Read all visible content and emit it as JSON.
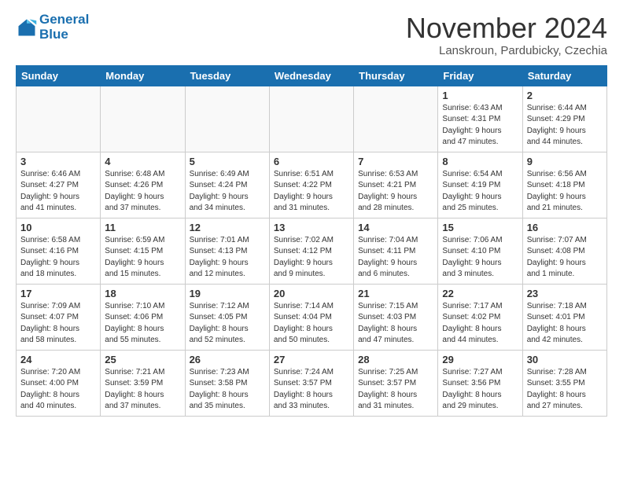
{
  "logo": {
    "line1": "General",
    "line2": "Blue"
  },
  "title": "November 2024",
  "location": "Lanskroun, Pardubicky, Czechia",
  "header_days": [
    "Sunday",
    "Monday",
    "Tuesday",
    "Wednesday",
    "Thursday",
    "Friday",
    "Saturday"
  ],
  "weeks": [
    [
      {
        "day": "",
        "info": ""
      },
      {
        "day": "",
        "info": ""
      },
      {
        "day": "",
        "info": ""
      },
      {
        "day": "",
        "info": ""
      },
      {
        "day": "",
        "info": ""
      },
      {
        "day": "1",
        "info": "Sunrise: 6:43 AM\nSunset: 4:31 PM\nDaylight: 9 hours\nand 47 minutes."
      },
      {
        "day": "2",
        "info": "Sunrise: 6:44 AM\nSunset: 4:29 PM\nDaylight: 9 hours\nand 44 minutes."
      }
    ],
    [
      {
        "day": "3",
        "info": "Sunrise: 6:46 AM\nSunset: 4:27 PM\nDaylight: 9 hours\nand 41 minutes."
      },
      {
        "day": "4",
        "info": "Sunrise: 6:48 AM\nSunset: 4:26 PM\nDaylight: 9 hours\nand 37 minutes."
      },
      {
        "day": "5",
        "info": "Sunrise: 6:49 AM\nSunset: 4:24 PM\nDaylight: 9 hours\nand 34 minutes."
      },
      {
        "day": "6",
        "info": "Sunrise: 6:51 AM\nSunset: 4:22 PM\nDaylight: 9 hours\nand 31 minutes."
      },
      {
        "day": "7",
        "info": "Sunrise: 6:53 AM\nSunset: 4:21 PM\nDaylight: 9 hours\nand 28 minutes."
      },
      {
        "day": "8",
        "info": "Sunrise: 6:54 AM\nSunset: 4:19 PM\nDaylight: 9 hours\nand 25 minutes."
      },
      {
        "day": "9",
        "info": "Sunrise: 6:56 AM\nSunset: 4:18 PM\nDaylight: 9 hours\nand 21 minutes."
      }
    ],
    [
      {
        "day": "10",
        "info": "Sunrise: 6:58 AM\nSunset: 4:16 PM\nDaylight: 9 hours\nand 18 minutes."
      },
      {
        "day": "11",
        "info": "Sunrise: 6:59 AM\nSunset: 4:15 PM\nDaylight: 9 hours\nand 15 minutes."
      },
      {
        "day": "12",
        "info": "Sunrise: 7:01 AM\nSunset: 4:13 PM\nDaylight: 9 hours\nand 12 minutes."
      },
      {
        "day": "13",
        "info": "Sunrise: 7:02 AM\nSunset: 4:12 PM\nDaylight: 9 hours\nand 9 minutes."
      },
      {
        "day": "14",
        "info": "Sunrise: 7:04 AM\nSunset: 4:11 PM\nDaylight: 9 hours\nand 6 minutes."
      },
      {
        "day": "15",
        "info": "Sunrise: 7:06 AM\nSunset: 4:10 PM\nDaylight: 9 hours\nand 3 minutes."
      },
      {
        "day": "16",
        "info": "Sunrise: 7:07 AM\nSunset: 4:08 PM\nDaylight: 9 hours\nand 1 minute."
      }
    ],
    [
      {
        "day": "17",
        "info": "Sunrise: 7:09 AM\nSunset: 4:07 PM\nDaylight: 8 hours\nand 58 minutes."
      },
      {
        "day": "18",
        "info": "Sunrise: 7:10 AM\nSunset: 4:06 PM\nDaylight: 8 hours\nand 55 minutes."
      },
      {
        "day": "19",
        "info": "Sunrise: 7:12 AM\nSunset: 4:05 PM\nDaylight: 8 hours\nand 52 minutes."
      },
      {
        "day": "20",
        "info": "Sunrise: 7:14 AM\nSunset: 4:04 PM\nDaylight: 8 hours\nand 50 minutes."
      },
      {
        "day": "21",
        "info": "Sunrise: 7:15 AM\nSunset: 4:03 PM\nDaylight: 8 hours\nand 47 minutes."
      },
      {
        "day": "22",
        "info": "Sunrise: 7:17 AM\nSunset: 4:02 PM\nDaylight: 8 hours\nand 44 minutes."
      },
      {
        "day": "23",
        "info": "Sunrise: 7:18 AM\nSunset: 4:01 PM\nDaylight: 8 hours\nand 42 minutes."
      }
    ],
    [
      {
        "day": "24",
        "info": "Sunrise: 7:20 AM\nSunset: 4:00 PM\nDaylight: 8 hours\nand 40 minutes."
      },
      {
        "day": "25",
        "info": "Sunrise: 7:21 AM\nSunset: 3:59 PM\nDaylight: 8 hours\nand 37 minutes."
      },
      {
        "day": "26",
        "info": "Sunrise: 7:23 AM\nSunset: 3:58 PM\nDaylight: 8 hours\nand 35 minutes."
      },
      {
        "day": "27",
        "info": "Sunrise: 7:24 AM\nSunset: 3:57 PM\nDaylight: 8 hours\nand 33 minutes."
      },
      {
        "day": "28",
        "info": "Sunrise: 7:25 AM\nSunset: 3:57 PM\nDaylight: 8 hours\nand 31 minutes."
      },
      {
        "day": "29",
        "info": "Sunrise: 7:27 AM\nSunset: 3:56 PM\nDaylight: 8 hours\nand 29 minutes."
      },
      {
        "day": "30",
        "info": "Sunrise: 7:28 AM\nSunset: 3:55 PM\nDaylight: 8 hours\nand 27 minutes."
      }
    ]
  ]
}
